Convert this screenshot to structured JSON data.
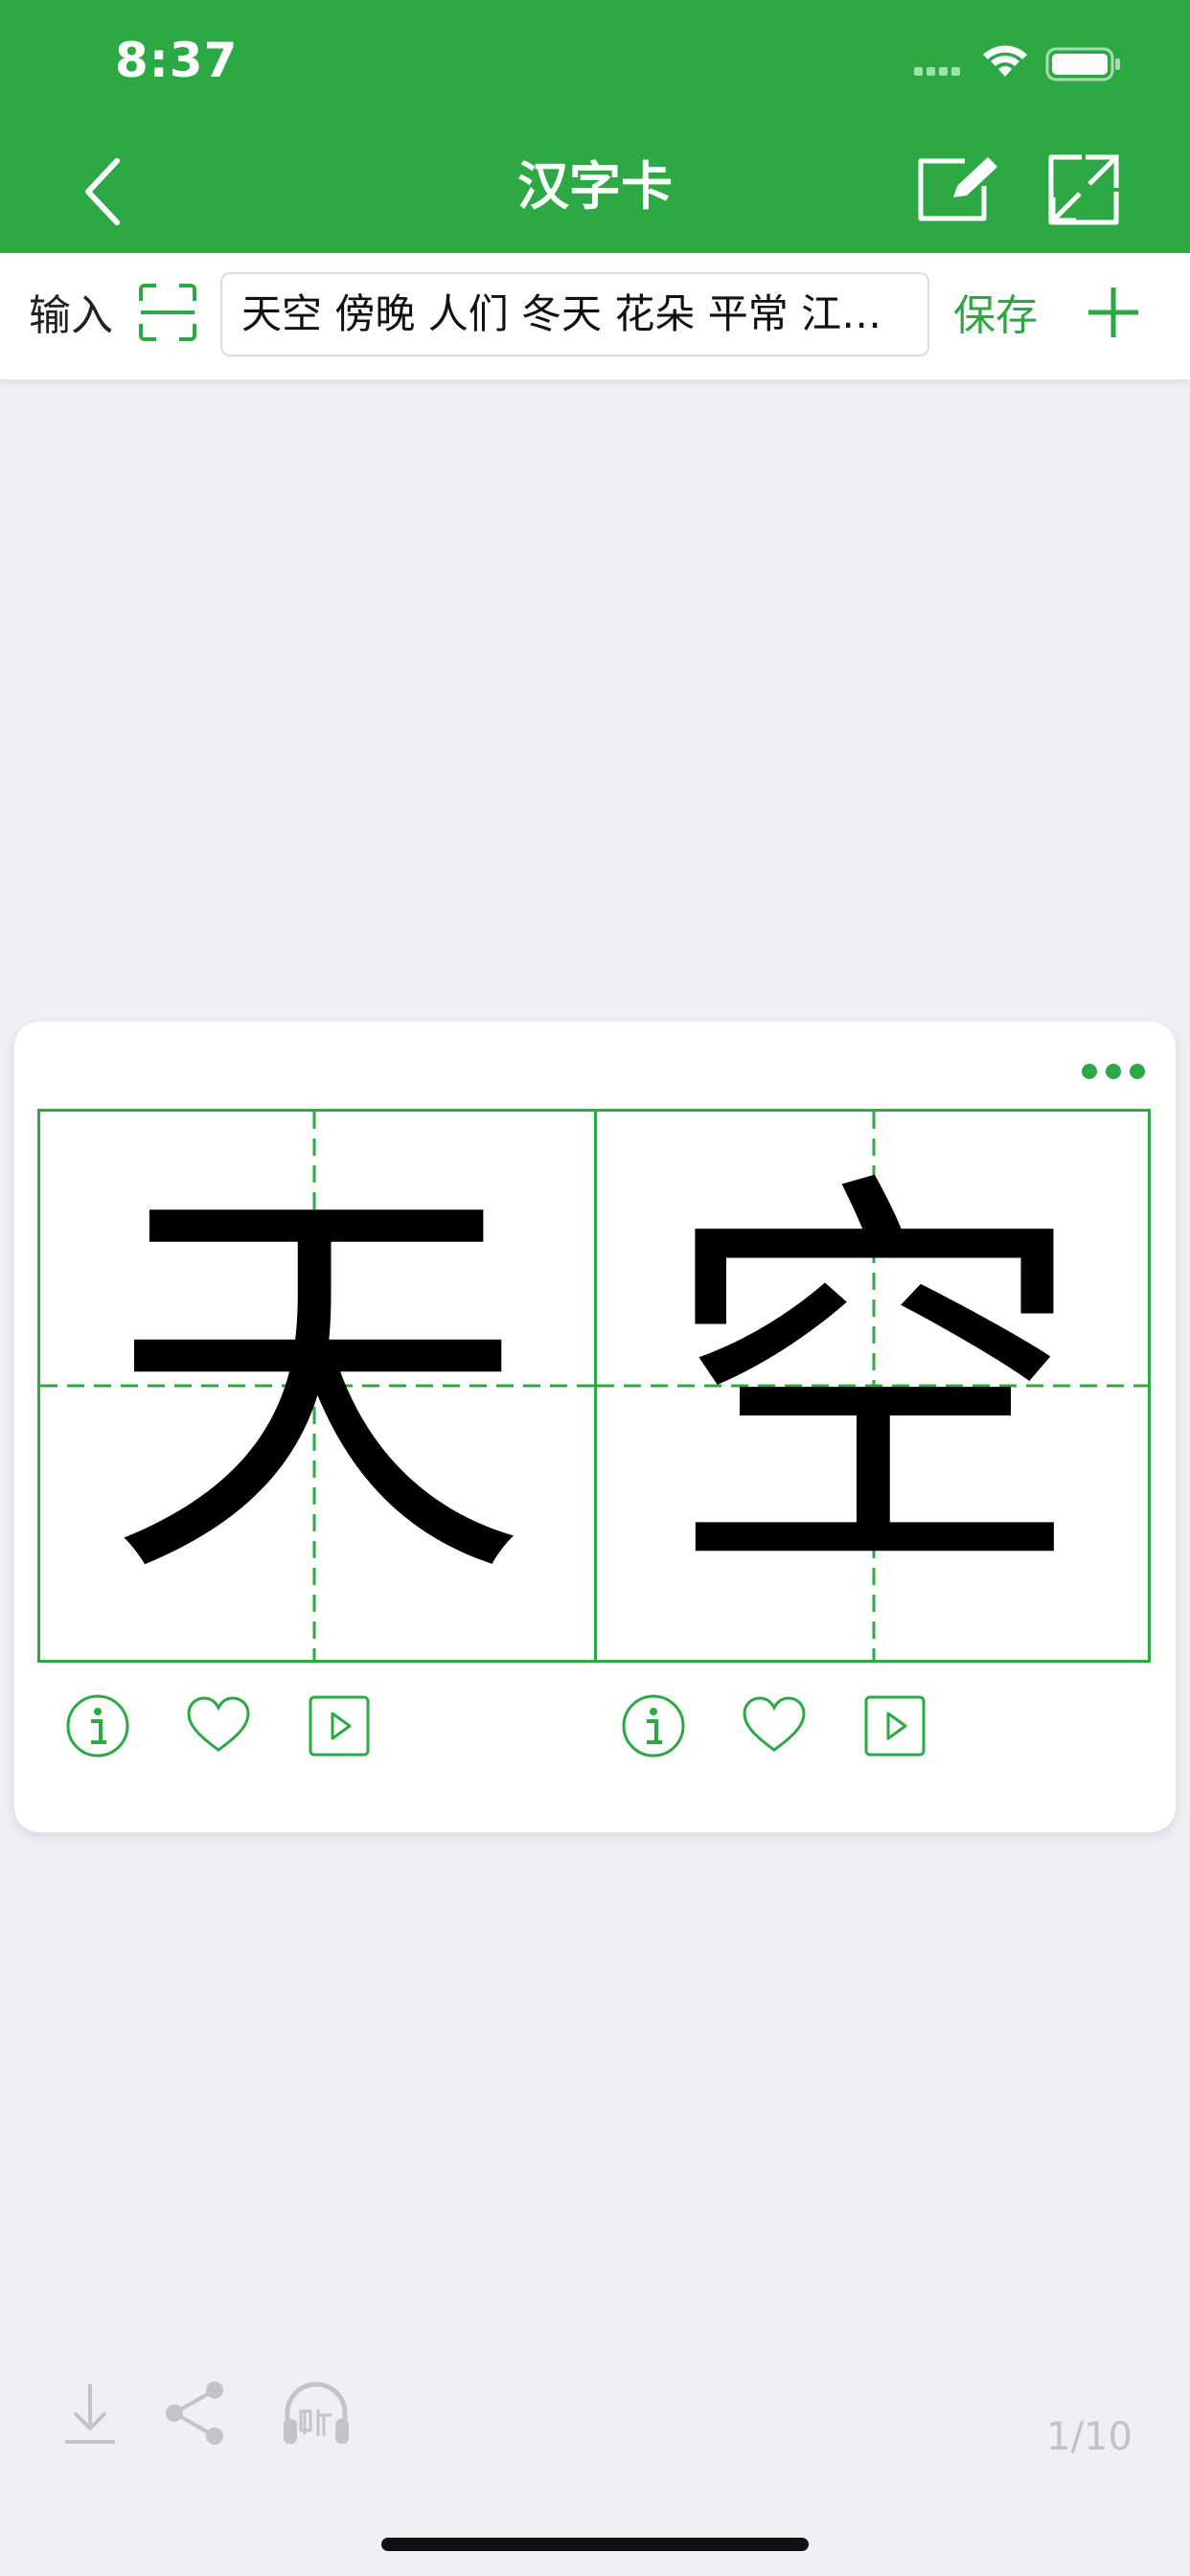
{
  "status_bar": {
    "time": "8:37"
  },
  "nav": {
    "title": "汉字卡",
    "back_icon": "chevron-left-icon",
    "edit_icon": "edit-icon",
    "expand_icon": "expand-icon"
  },
  "input_bar": {
    "label": "输入",
    "value": "天空 傍晚 人们 冬天 花朵 平常 江河…",
    "save_label": "保存"
  },
  "card": {
    "characters": [
      "天",
      "空"
    ]
  },
  "pagination": {
    "current": "1/10"
  },
  "colors": {
    "accent": "#2ca944",
    "background": "#efeff4"
  }
}
